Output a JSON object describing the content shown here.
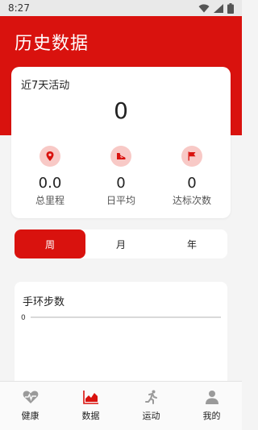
{
  "status": {
    "time": "8:27"
  },
  "header": {
    "title": "历史数据"
  },
  "summary": {
    "title": "近7天活动",
    "count": "0",
    "stats": [
      {
        "value": "0.0",
        "label": "总里程",
        "icon": "location-pin-icon"
      },
      {
        "value": "0",
        "label": "日平均",
        "icon": "shoe-icon"
      },
      {
        "value": "0",
        "label": "达标次数",
        "icon": "flag-icon"
      }
    ]
  },
  "tabs": [
    {
      "label": "周",
      "active": true
    },
    {
      "label": "月",
      "active": false
    },
    {
      "label": "年",
      "active": false
    }
  ],
  "chart": {
    "title": "手环步数",
    "chart_data": {
      "type": "line",
      "title": "手环步数",
      "y_tick_labels": [
        "0"
      ],
      "series": [
        {
          "values": []
        }
      ]
    }
  },
  "nav": [
    {
      "label": "健康",
      "icon": "heart-pulse-icon"
    },
    {
      "label": "数据",
      "icon": "chart-icon"
    },
    {
      "label": "运动",
      "icon": "running-icon"
    },
    {
      "label": "我的",
      "icon": "person-icon"
    }
  ],
  "colors": {
    "primary": "#d9120e",
    "icon_bg": "#f8c9c6",
    "nav_icon": "#9a9a9a"
  }
}
